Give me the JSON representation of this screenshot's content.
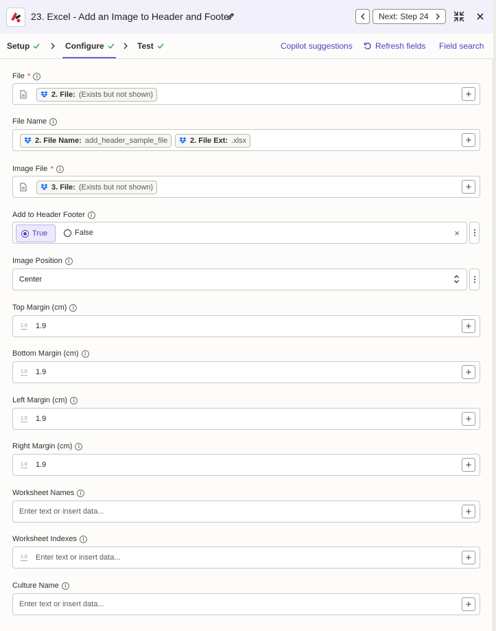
{
  "header": {
    "title": "23. Excel - Add an Image to Header and Footer",
    "next_label": "Next: Step 24"
  },
  "tabs": {
    "setup": "Setup",
    "configure": "Configure",
    "test": "Test",
    "copilot": "Copilot suggestions",
    "refresh": "Refresh fields",
    "field_search": "Field search"
  },
  "colors": {
    "accent": "#695be8",
    "check": "#2e9e5b",
    "required": "#e4540f",
    "dropbox": "#0061fe"
  },
  "fields": {
    "file": {
      "label": "File",
      "pill_step": "2. File:",
      "pill_value": "(Exists but not shown)"
    },
    "file_name": {
      "label": "File Name",
      "pill1_step": "2. File Name:",
      "pill1_value": "add_header_sample_file",
      "pill2_step": "2. File Ext:",
      "pill2_value": ".xlsx"
    },
    "image_file": {
      "label": "Image File",
      "pill_step": "3. File:",
      "pill_value": "(Exists but not shown)"
    },
    "add_to_header_footer": {
      "label": "Add to Header Footer",
      "option_true": "True",
      "option_false": "False",
      "selected": "True"
    },
    "image_position": {
      "label": "Image Position",
      "value": "Center"
    },
    "top_margin": {
      "label": "Top Margin (cm)",
      "value": "1.9"
    },
    "bottom_margin": {
      "label": "Bottom Margin (cm)",
      "value": "1.9"
    },
    "left_margin": {
      "label": "Left Margin (cm)",
      "value": "1.9"
    },
    "right_margin": {
      "label": "Right Margin (cm)",
      "value": "1.9"
    },
    "worksheet_names": {
      "label": "Worksheet Names",
      "placeholder": "Enter text or insert data..."
    },
    "worksheet_indexes": {
      "label": "Worksheet Indexes",
      "placeholder": "Enter text or insert data..."
    },
    "culture_name": {
      "label": "Culture Name",
      "placeholder": "Enter text or insert data..."
    }
  },
  "icons": {
    "required_mark": "*",
    "info": "i",
    "number_type": "1.0",
    "clear": "×",
    "plus": "+"
  }
}
